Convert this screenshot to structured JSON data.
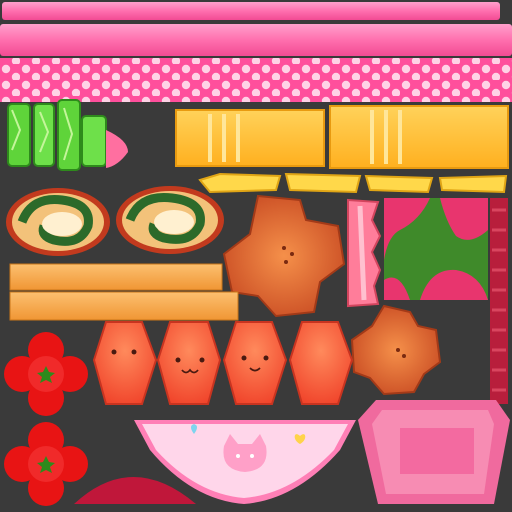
{
  "texture_atlas": {
    "background": "#3a3a3a",
    "pieces": [
      {
        "name": "pink-ribbon-top-strip",
        "color": "#ff6fae"
      },
      {
        "name": "pink-ribbon-bottom-strip",
        "color": "#ff5fa3"
      },
      {
        "name": "pink-polka-dot-band",
        "color": "#ff4f9c",
        "dot_color": "#ffd2e6"
      },
      {
        "name": "green-cucumber-slices",
        "color": "#5fd43a"
      },
      {
        "name": "pink-fishcake-wedge",
        "color": "#ff6fa0"
      },
      {
        "name": "tamagoyaki-block-left",
        "color": "#ffbe2e"
      },
      {
        "name": "tamagoyaki-block-right",
        "color": "#ffbe2e"
      },
      {
        "name": "corn-kernel-strips",
        "color": "#ffd84a"
      },
      {
        "name": "spinach-egg-roll-left",
        "color": "#f3c27a"
      },
      {
        "name": "spinach-egg-roll-right",
        "color": "#f3c27a"
      },
      {
        "name": "fried-chicken-large",
        "color": "#e8652e"
      },
      {
        "name": "fried-chicken-small",
        "color": "#e0602a"
      },
      {
        "name": "ham-slice-edge",
        "color": "#ff7d9a"
      },
      {
        "name": "watermelon-pattern-patch",
        "color": "#e8356e"
      },
      {
        "name": "red-border-strip",
        "color": "#b81e3c"
      },
      {
        "name": "orange-pasta-bar-top",
        "color": "#f8a94a"
      },
      {
        "name": "orange-pasta-bar-bottom",
        "color": "#f8a94a"
      },
      {
        "name": "red-flower-tomato-top",
        "color": "#e81414"
      },
      {
        "name": "red-flower-tomato-bottom",
        "color": "#e81414"
      },
      {
        "name": "octopus-sausage-plain",
        "color": "#ff5a3c"
      },
      {
        "name": "octopus-sausage-cat-face",
        "color": "#ff5a3c"
      },
      {
        "name": "octopus-sausage-smile",
        "color": "#ff5a3c"
      },
      {
        "name": "octopus-sausage-blank",
        "color": "#ff5a3c"
      },
      {
        "name": "pink-cat-bowl-skirt",
        "color": "#ffd6ea",
        "accent": "#ff7fb6"
      },
      {
        "name": "pink-lunchbox-tray",
        "color": "#f06a9e"
      },
      {
        "name": "red-rice-dome",
        "color": "#c0173a"
      }
    ]
  }
}
